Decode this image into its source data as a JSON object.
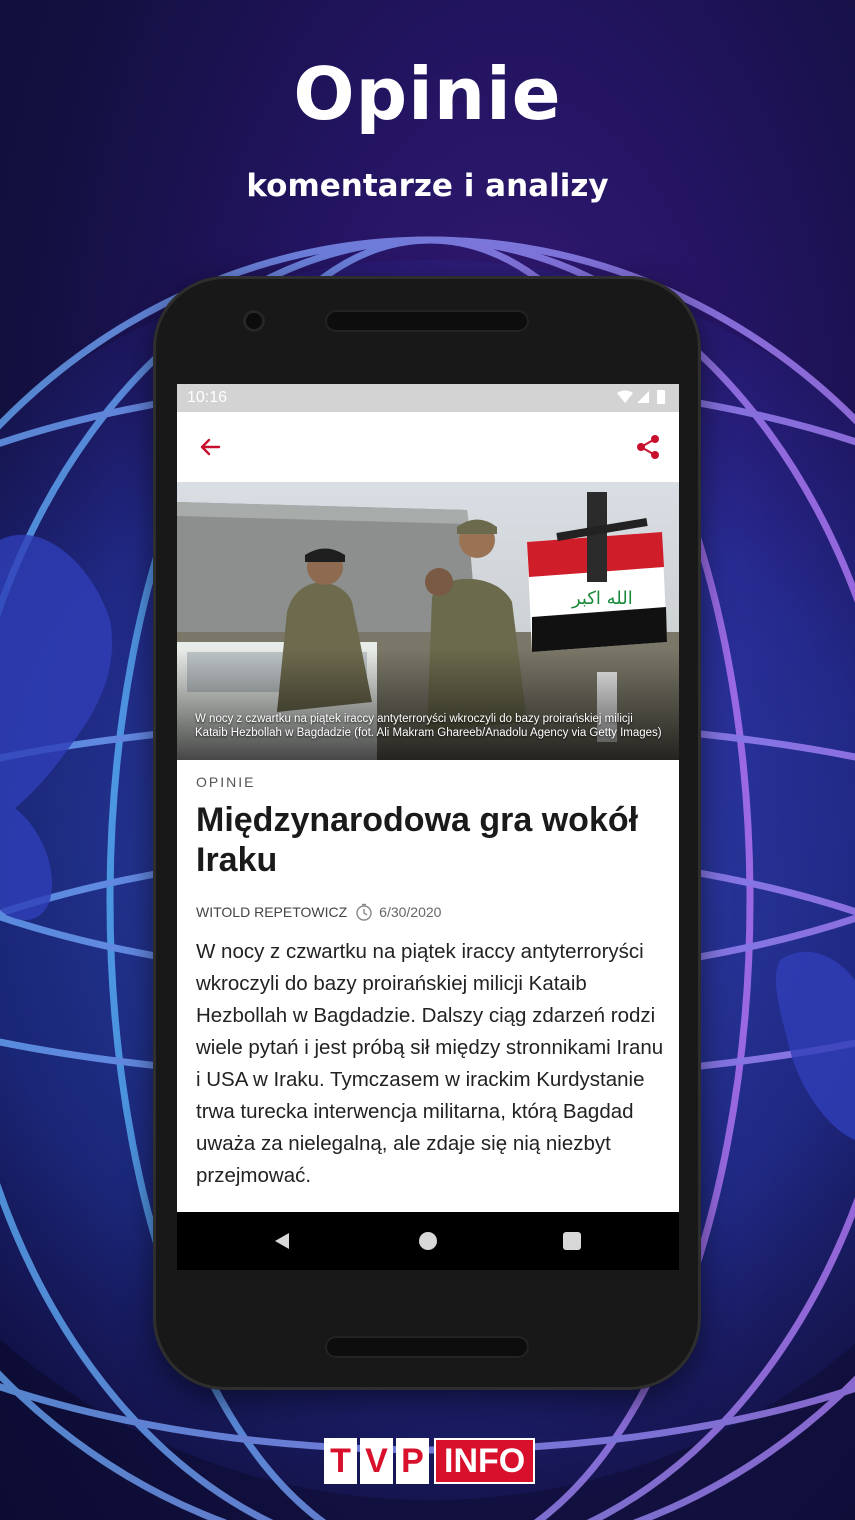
{
  "promo": {
    "headline": "Opinie",
    "subheadline": "komentarze i analizy"
  },
  "status_bar": {
    "time": "10:16"
  },
  "app_bar": {
    "back_icon": "arrow-left-icon",
    "share_icon": "share-icon",
    "accent_color": "#c8102e"
  },
  "article": {
    "image_caption": "W nocy z czwartku na piątek iraccy antyterroryści wkroczyli do bazy proirańskiej milicji Kataib Hezbollah w Bagdadzie (fot. Ali Makram Ghareeb/Anadolu Agency via Getty Images)",
    "category": "OPINIE",
    "title": "Międzynarodowa gra wokół Iraku",
    "author": "WITOLD REPETOWICZ",
    "date": "6/30/2020",
    "body": "W nocy z czwartku na piątek iraccy antyterroryści wkroczyli do bazy proirańskiej milicji Kataib Hezbollah w Bagdadzie. Dalszy ciąg zdarzeń rodzi wiele pytań i jest próbą sił między stronnikami Iranu i USA w Iraku. Tymczasem w irackim Kurdystanie trwa turecka interwencja militarna, którą Bagdad uważa za nielegalną, ale zdaje się nią niezbyt przejmować."
  },
  "logo": {
    "letters": [
      "T",
      "V",
      "P"
    ],
    "suffix": "INFO",
    "brand_color": "#d8102b"
  }
}
